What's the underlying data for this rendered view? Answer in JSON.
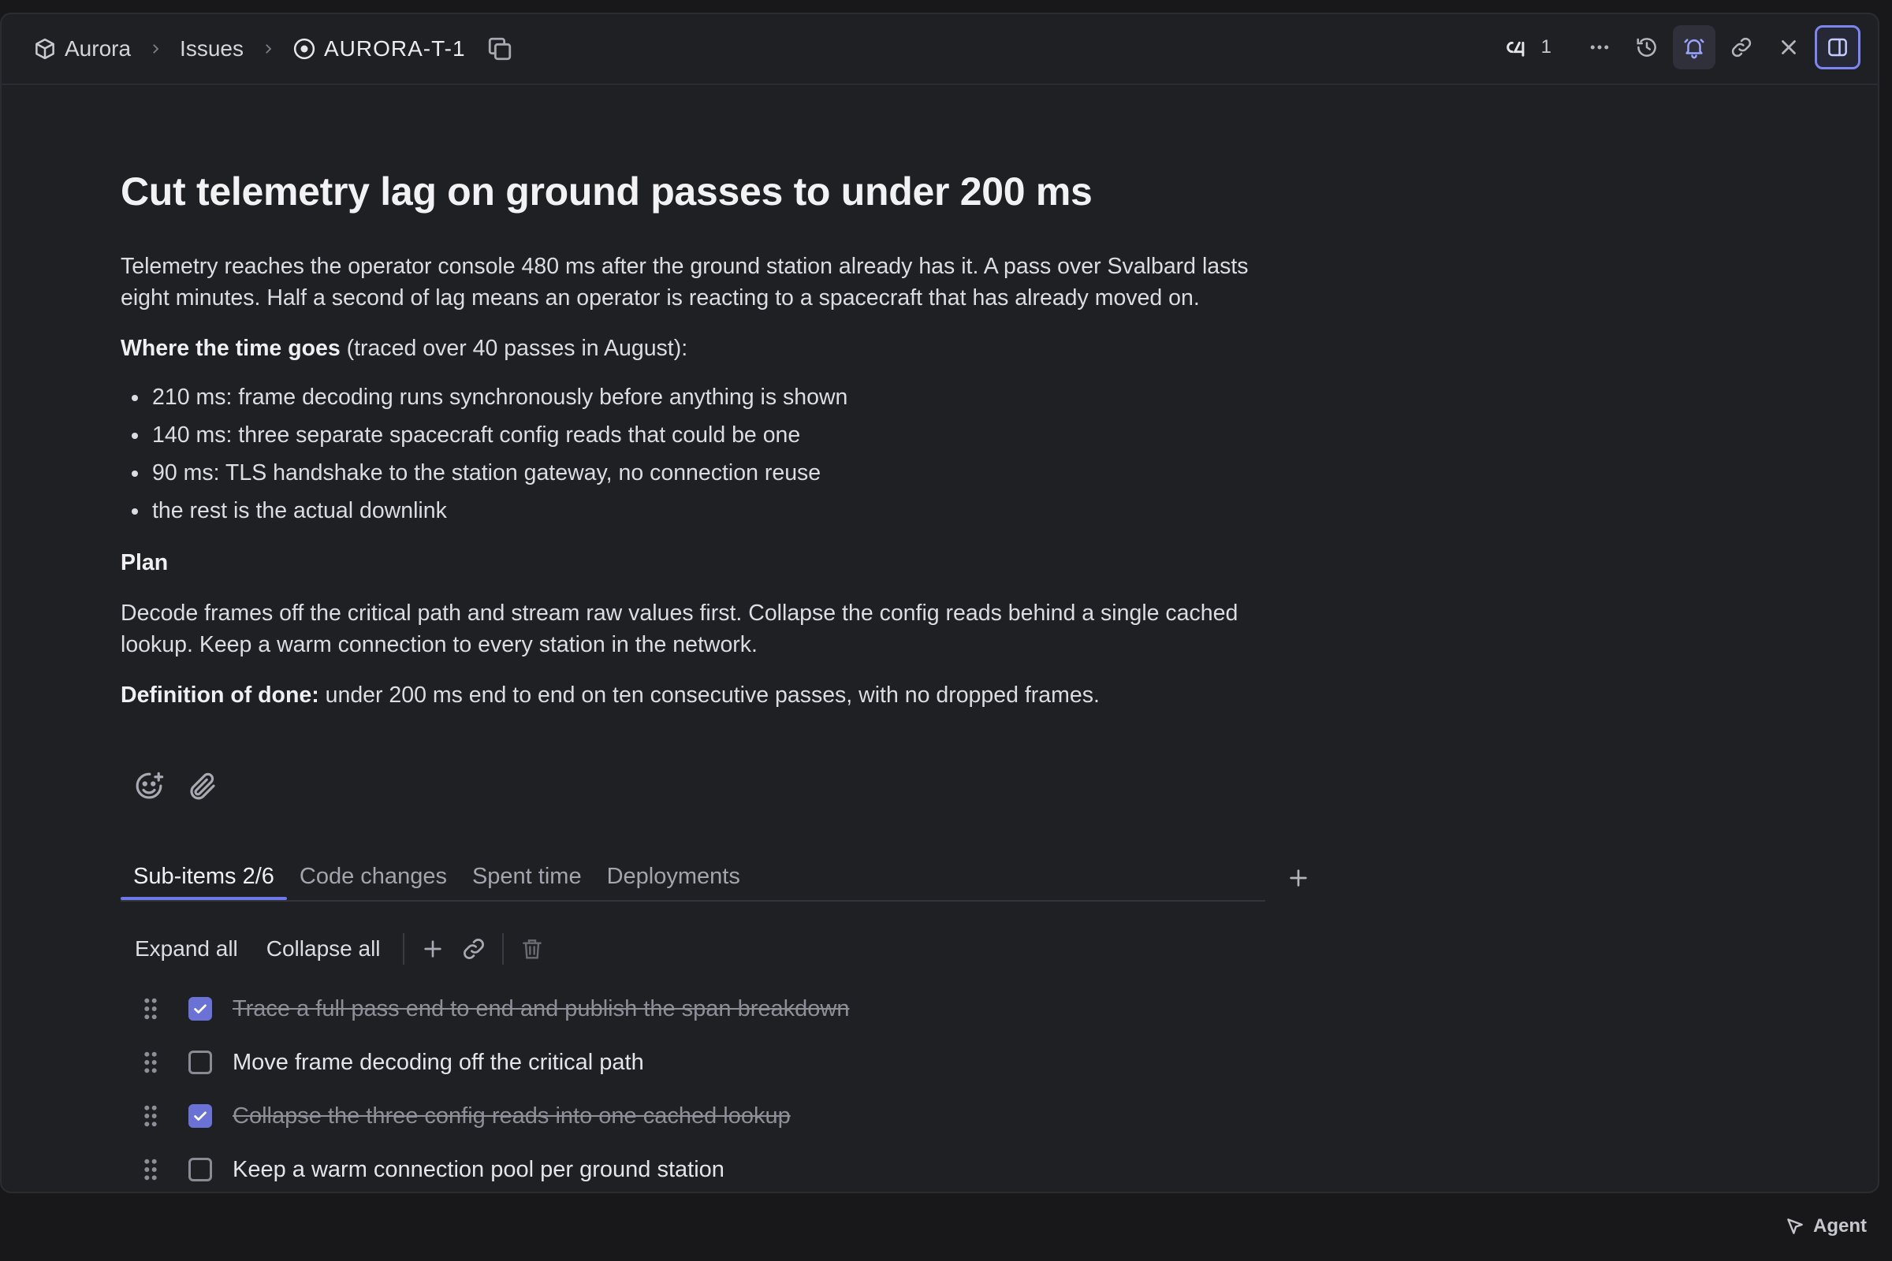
{
  "breadcrumb": {
    "project": "Aurora",
    "section": "Issues",
    "issue_id": "AURORA-T-1"
  },
  "header_actions": {
    "relations_count": "1"
  },
  "issue": {
    "title": "Cut telemetry lag on ground passes to under 200 ms",
    "intro_line1": "Telemetry reaches the operator console 480 ms after the ground station already has it. A pass over Svalbard lasts",
    "intro_line2": "eight minutes. Half a second of lag means an operator is reacting to a spacecraft that has already moved on.",
    "where_heading": "Where the time goes",
    "where_note": " (traced over 40 passes in August):",
    "bullets": [
      "210 ms: frame decoding runs synchronously before anything is shown",
      "140 ms: three separate spacecraft config reads that could be one",
      "90 ms: TLS handshake to the station gateway, no connection reuse",
      "the rest is the actual downlink"
    ],
    "plan_heading": "Plan",
    "plan_line1": "Decode frames off the critical path and stream raw values first. Collapse the config reads behind a single cached",
    "plan_line2": "lookup. Keep a warm connection to every station in the network.",
    "done_label": "Definition of done:",
    "done_text": " under 200 ms end to end on ten consecutive passes, with no dropped frames."
  },
  "tabs": [
    {
      "label": "Sub-items 2/6",
      "active": true
    },
    {
      "label": "Code changes",
      "active": false
    },
    {
      "label": "Spent time",
      "active": false
    },
    {
      "label": "Deployments",
      "active": false
    }
  ],
  "subitems_toolbar": {
    "expand_all": "Expand all",
    "collapse_all": "Collapse all"
  },
  "subitems": [
    {
      "label": "Trace a full pass end to end and publish the span breakdown",
      "done": true
    },
    {
      "label": "Move frame decoding off the critical path",
      "done": false
    },
    {
      "label": "Collapse the three config reads into one cached lookup",
      "done": true
    },
    {
      "label": "Keep a warm connection pool per ground station",
      "done": false
    }
  ],
  "footer": {
    "agent_label": "Agent"
  },
  "colors": {
    "accent": "#6f78e8",
    "checkbox_checked": "#6b72d6",
    "panel_bg": "#1f2023",
    "page_bg": "#18181b"
  }
}
